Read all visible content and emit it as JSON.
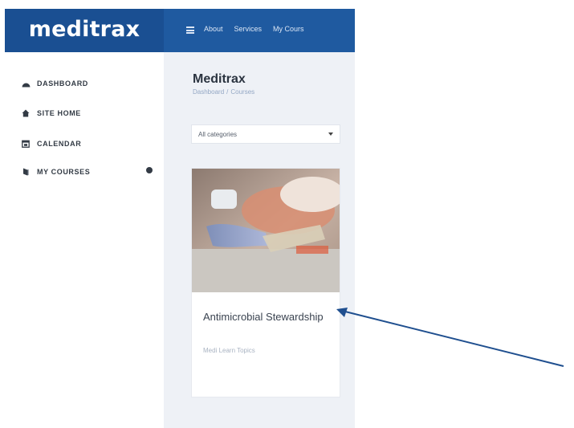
{
  "app": {
    "logo": "meditrax"
  },
  "topnav": {
    "items": [
      "About",
      "Services",
      "My Cours"
    ]
  },
  "sidebar": {
    "items": [
      {
        "label": "DASHBOARD",
        "icon": "dashboard-icon"
      },
      {
        "label": "SITE HOME",
        "icon": "home-icon"
      },
      {
        "label": "CALENDAR",
        "icon": "calendar-icon"
      },
      {
        "label": "MY COURSES",
        "icon": "graduation-cap-icon"
      }
    ]
  },
  "main": {
    "title": "Meditrax",
    "breadcrumb": [
      "Dashboard",
      "/",
      "Courses"
    ],
    "category_select": {
      "value": "All categories"
    }
  },
  "course_card": {
    "title": "Antimicrobial Stewardship",
    "category": "Medi Learn Topics"
  },
  "colors": {
    "header": "#1f5aa0",
    "brand": "#1a4f92",
    "content_bg": "#eef1f6",
    "arrow": "#1f4f8f"
  }
}
